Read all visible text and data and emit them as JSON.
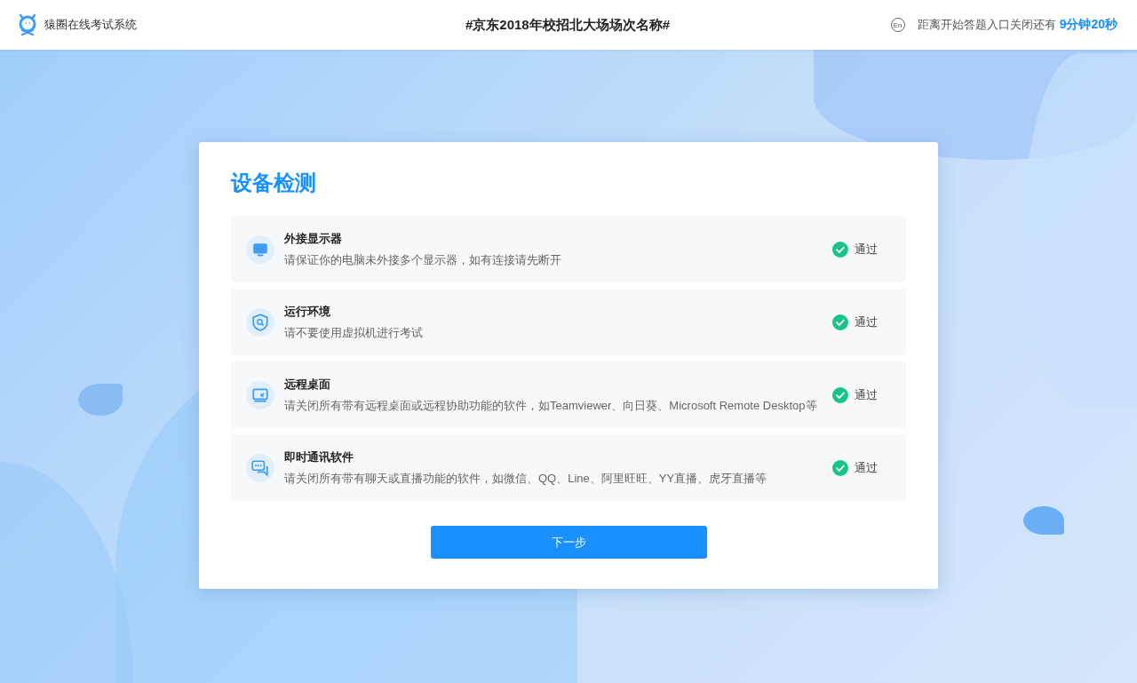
{
  "header": {
    "app_name": "猿圈在线考试系统",
    "exam_title": "#京东2018年校招北大场场次名称#",
    "language_toggle": "En",
    "countdown_label": "距离开始答题入口关闭还有",
    "countdown_value": "9分钟20秒"
  },
  "card": {
    "title": "设备检测",
    "checks": [
      {
        "kind": "monitor",
        "title": "外接显示器",
        "description": "请保证你的电脑未外接多个显示器，如有连接请先断开",
        "passed": true,
        "status": "通过"
      },
      {
        "kind": "shield",
        "title": "运行环境",
        "description": "请不要使用虚拟机进行考试",
        "passed": true,
        "status": "通过"
      },
      {
        "kind": "remote",
        "title": "远程桌面",
        "description": "请关闭所有带有远程桌面或远程协助功能的软件，如Teamviewer、向日葵、Microsoft Remote Desktop等",
        "passed": true,
        "status": "通过"
      },
      {
        "kind": "chat",
        "title": "即时通讯软件",
        "description": "请关闭所有带有聊天或直播功能的软件，如微信、QQ、Line、阿里旺旺、YY直播、虎牙直播等",
        "passed": true,
        "status": "通过"
      }
    ],
    "next_button": "下一步"
  }
}
